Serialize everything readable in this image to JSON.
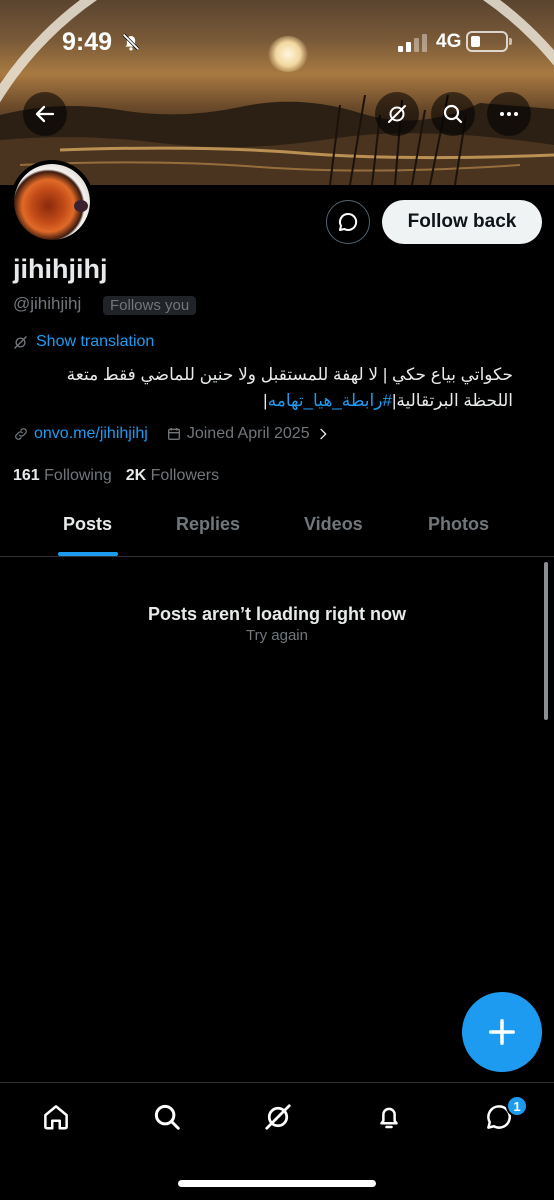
{
  "status_bar": {
    "time": "9:49",
    "network": "4G"
  },
  "profile": {
    "name": "jihihjihj",
    "handle": "@jihihjihj",
    "follows_you": "Follows you",
    "show_translation": "Show translation",
    "bio_text": "حكواتي بياع حكي | لا لهفة للمستقبل ولا حنين للماضي فقط متعة اللحظة البرتقالية|",
    "bio_hashtag": "#رابطة_هيا_تهامه",
    "bio_end": "|",
    "link": "onvo.me/jihihjihj",
    "joined": "Joined April 2025",
    "following_count": "161",
    "following_label": "Following",
    "followers_count": "2K",
    "followers_label": "Followers"
  },
  "actions": {
    "follow_back": "Follow back"
  },
  "tabs": [
    {
      "label": "Posts",
      "active": true
    },
    {
      "label": "Replies",
      "active": false
    },
    {
      "label": "Videos",
      "active": false
    },
    {
      "label": "Photos",
      "active": false
    }
  ],
  "feed": {
    "error_title": "Posts aren’t loading right now",
    "retry": "Try again"
  },
  "bottom_nav": {
    "messages_badge": "1"
  },
  "colors": {
    "accent": "#1d9bf0",
    "background": "#000000",
    "muted": "#71767b"
  }
}
